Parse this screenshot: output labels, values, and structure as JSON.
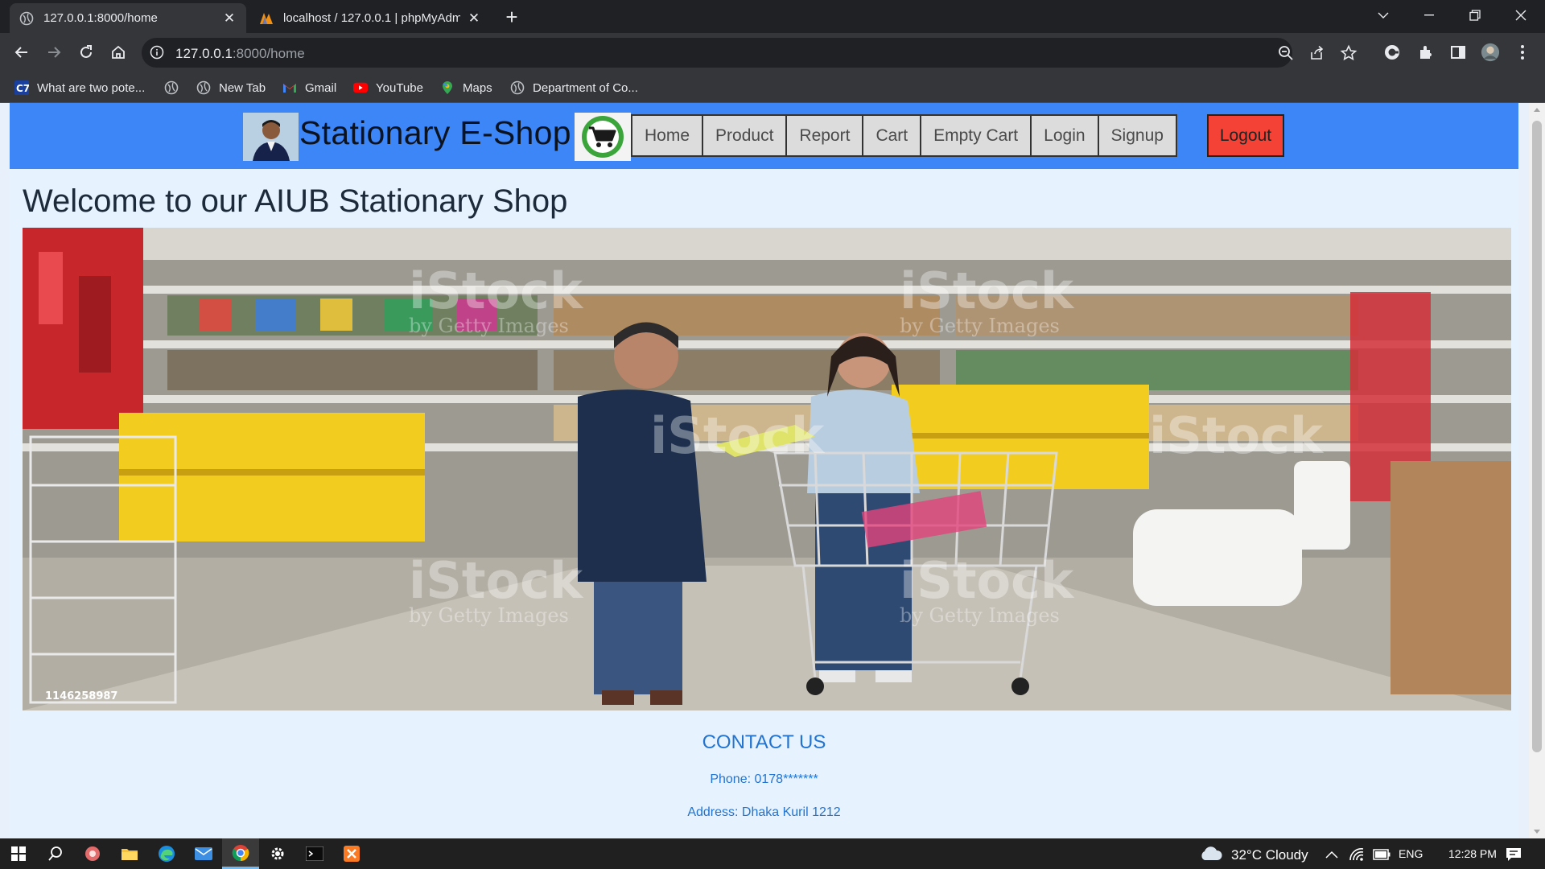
{
  "browser": {
    "tabs": [
      {
        "title": "127.0.0.1:8000/home",
        "active": true
      },
      {
        "title": "localhost / 127.0.0.1 | phpMyAdmin",
        "active": false
      }
    ],
    "address": {
      "host": "127.0.0.1",
      "rest": ":8000/home"
    },
    "bookmarks": [
      {
        "label": "What are two pote...",
        "icon": "c7-icon"
      },
      {
        "label": "",
        "icon": "globe-icon"
      },
      {
        "label": "New Tab",
        "icon": "globe-icon"
      },
      {
        "label": "Gmail",
        "icon": "gmail-icon"
      },
      {
        "label": "YouTube",
        "icon": "youtube-icon"
      },
      {
        "label": "Maps",
        "icon": "maps-icon"
      },
      {
        "label": "Department of Co...",
        "icon": "globe-icon"
      }
    ]
  },
  "site": {
    "brand": "Stationary E-Shop",
    "nav": [
      "Home",
      "Product",
      "Report",
      "Cart",
      "Empty Cart",
      "Login",
      "Signup"
    ],
    "logout": "Logout",
    "welcome": "Welcome to our AIUB Stationary Shop",
    "hero": {
      "watermark": "iStock",
      "watermark_sub": "by Getty Images",
      "image_id": "1146258987"
    },
    "contact": {
      "title": "CONTACT US",
      "phone": "Phone: 0178*******",
      "address": "Address: Dhaka Kuril 1212"
    }
  },
  "taskbar": {
    "weather": "32°C  Cloudy",
    "language": "ENG",
    "time": "12:28 PM"
  },
  "colors": {
    "header": "#3d86f7",
    "page_bg": "#e6f2fd",
    "logout": "#f44336",
    "contact": "#2374d1"
  }
}
